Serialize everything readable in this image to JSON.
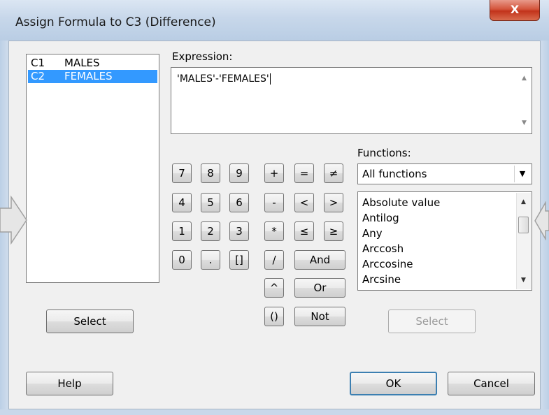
{
  "window": {
    "title": "Assign Formula to C3 (Difference)",
    "close_glyph": "X"
  },
  "columns": [
    {
      "id": "C1",
      "name": "MALES",
      "selected": false
    },
    {
      "id": "C2",
      "name": "FEMALES",
      "selected": true
    }
  ],
  "expression": {
    "label": "Expression:",
    "value": "'MALES'-'FEMALES'"
  },
  "keypad": {
    "digits": [
      "7",
      "8",
      "9",
      "4",
      "5",
      "6",
      "1",
      "2",
      "3",
      "0",
      ".",
      "[]"
    ],
    "operators": [
      "+",
      "-",
      "*",
      "/",
      "^",
      "()"
    ],
    "comparisons": [
      "=",
      "≠",
      "<",
      ">",
      "≤",
      "≥"
    ],
    "logical": [
      "And",
      "Or",
      "Not"
    ]
  },
  "functions": {
    "label": "Functions:",
    "category": "All functions",
    "items": [
      "Absolute value",
      "Antilog",
      "Any",
      "Arccosh",
      "Arccosine",
      "Arcsine"
    ]
  },
  "buttons": {
    "select_columns": "Select",
    "select_function": "Select",
    "help": "Help",
    "ok": "OK",
    "cancel": "Cancel"
  },
  "colors": {
    "selection": "#3399ff",
    "dialog_bg": "#f0f0f0",
    "title_bg": "#c7d7ea",
    "close_red": "#c2331b"
  }
}
